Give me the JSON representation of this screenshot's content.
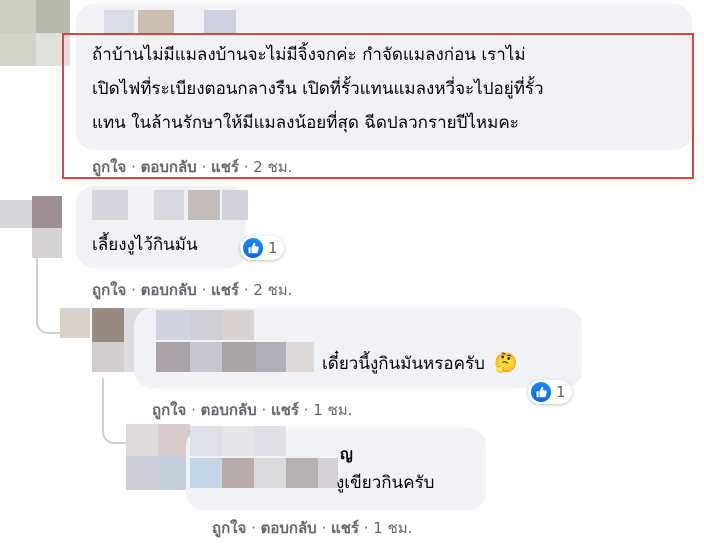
{
  "comment1": {
    "lines": [
      "ถ้าบ้านไม่มีแมลงบ้านจะไม่มีจิ้งจกค่ะ กำจัดแมลงก่อน เราไม่",
      "เปิดไฟที่ระเบียงตอนกลางรืน เปิดที่รั้วแทนแมลงหวี่จะไปอยู่ที่รั้ว",
      "แทน ในล้านรักษาให้มีแมลงน้อยที่สุด ฉีดปลวกรายปีไหมคะ"
    ],
    "like": "ถูกใจ",
    "reply": "ตอบกลับ",
    "share": "แชร์",
    "time": "2 ชม."
  },
  "comment2": {
    "text": "เลี้ยงงูไว้กินมัน",
    "reaction_count": "1",
    "like": "ถูกใจ",
    "reply": "ตอบกลับ",
    "share": "แชร์",
    "time": "2 ชม."
  },
  "comment3": {
    "text": "เดี๋ยวนี้งูกินมันหรอครับ",
    "emoji": "🤔",
    "reaction_count": "1",
    "like": "ถูกใจ",
    "reply": "ตอบกลับ",
    "share": "แชร์",
    "time": "1 ชม."
  },
  "comment4": {
    "name_fragment": "ญ",
    "text": "งูเขียวกินครับ",
    "like": "ถูกใจ",
    "reply": "ตอบกลับ",
    "share": "แชร์",
    "time": "1 ชม."
  },
  "separator": "·",
  "colors": {
    "bubble": "#f0f2f5",
    "highlight": "#e0423e",
    "meta": "#65676b",
    "like_blue": "#0866ff"
  }
}
